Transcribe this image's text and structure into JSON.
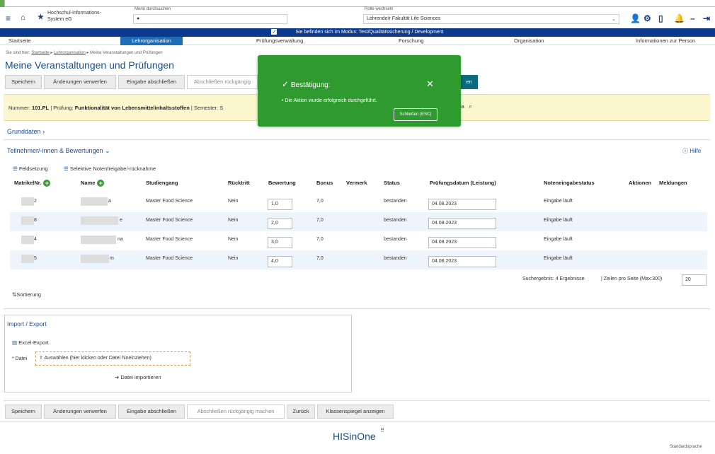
{
  "header": {
    "org_line1": "Hochschul-Informations-",
    "org_line2": "System eG",
    "menu_search_label": "Menü durchsuchen",
    "menu_search_value": "",
    "role_label": "Rolle wechseln",
    "role_value": "Lehrende/r Fakultät Life Sciences"
  },
  "mode_bar": {
    "text": "Sie befinden sich im Modus: Test/Qualitätssicherung / Development"
  },
  "nav": {
    "items": [
      {
        "label": "Startseite"
      },
      {
        "label": "Lehrorganisation"
      },
      {
        "label": "Prüfungsverwaltung"
      },
      {
        "label": "Forschung"
      },
      {
        "label": "Organisation"
      },
      {
        "label": "Informationen zur Person"
      }
    ]
  },
  "breadcrumb": {
    "prefix": "Sie sind hier:",
    "items": [
      "Startseite",
      "Lehrorganisation",
      "Meine Veranstaltungen und Prüfungen"
    ]
  },
  "page_title": "Meine Veranstaltungen und Prüfungen",
  "toolbar_top": {
    "save": "Speichern",
    "discard": "Änderungen verwerfen",
    "finish": "Eingabe abschließen",
    "undo": "Abschließen rückgängig",
    "primary_tail": "en"
  },
  "info_band": {
    "number_label": "Nummer:",
    "number_value": "101.PL",
    "exam_label": "Prüfung:",
    "exam_value": "Funktionalität von Lebensmittelinhaltsstoffen",
    "semester_label": "Semester: S",
    "tail": "ia"
  },
  "sections": {
    "grunddaten": "Grunddaten",
    "participants": "Teilnehmer/-innen & Bewertungen",
    "help": "Hilfe",
    "fields": "Feldsetzung",
    "selective": "Selektive Notenfreigabe/-rücknahme",
    "sorting": "Sortierung"
  },
  "table": {
    "headers": [
      "MatrikelNr.",
      "Name",
      "Studiengang",
      "Rücktritt",
      "Bewertung",
      "Bonus",
      "Vermerk",
      "Status",
      "Prüfungsdatum (Leistung)",
      "Noteneingabestatus",
      "Aktionen",
      "Meldungen"
    ],
    "rows": [
      {
        "matrikel": "2",
        "name": "a",
        "studiengang": "Master Food Science",
        "ruecktritt": "Nein",
        "bewertung": "1,0",
        "bonus": "7,0",
        "status": "bestanden",
        "datum": "04.08.2023",
        "eingabestatus": "Eingabe läuft"
      },
      {
        "matrikel": "8",
        "name": "e",
        "studiengang": "Master Food Science",
        "ruecktritt": "Nein",
        "bewertung": "2,0",
        "bonus": "7,0",
        "status": "bestanden",
        "datum": "04.08.2023",
        "eingabestatus": "Eingabe läuft"
      },
      {
        "matrikel": "4",
        "name": "na",
        "studiengang": "Master Food Science",
        "ruecktritt": "Nein",
        "bewertung": "3,0",
        "bonus": "7,0",
        "status": "bestanden",
        "datum": "04.08.2023",
        "eingabestatus": "Eingabe läuft"
      },
      {
        "matrikel": "5",
        "name": "m",
        "studiengang": "Master Food Science",
        "ruecktritt": "Nein",
        "bewertung": "4,0",
        "bonus": "7,0",
        "status": "bestanden",
        "datum": "04.08.2023",
        "eingabestatus": "Eingabe läuft"
      }
    ],
    "results": "Suchergebnis: 4 Ergebnisse",
    "rows_per_page_label": "Zeilen pro Seite (Max:300)",
    "rows_per_page_value": "20"
  },
  "import_export": {
    "title": "Import / Export",
    "excel": "Excel-Export",
    "file_label": "* Datei",
    "file_drop": "Auswählen (hier klicken oder Datei hineinziehen)",
    "import_btn": "Datei importieren"
  },
  "toolbar_bottom": {
    "save": "Speichern",
    "discard": "Änderungen verwerfen",
    "finish": "Eingabe abschließen",
    "undo": "Abschließen rückgängig machen",
    "back": "Zurück",
    "mirror": "Klassenspiegel anzeigen"
  },
  "toast": {
    "title": "Bestätigung:",
    "message": "Die Aktion wurde erfolgreich durchgeführt.",
    "close_btn": "Schließen (ESC)"
  },
  "footer": {
    "logo": "HISinOne",
    "language": "Standardsprache"
  },
  "colors": {
    "brand_blue": "#0c3a8c",
    "nav_active": "#1f6db8",
    "toast_green": "#2f9a2f",
    "info_yellow": "#fdf7cf"
  }
}
